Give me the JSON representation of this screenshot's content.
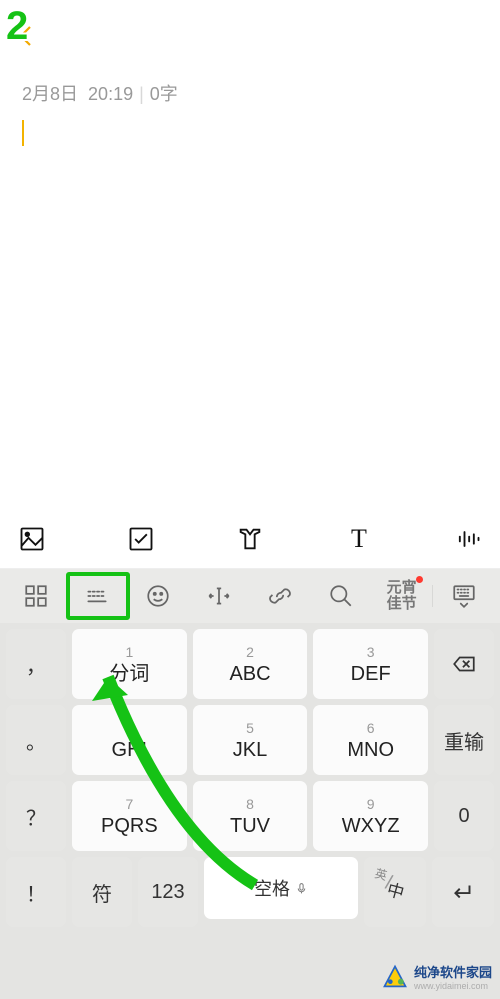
{
  "step_number": "2",
  "meta": {
    "date": "2月8日",
    "time": "20:19",
    "chars": "0字"
  },
  "toolbar": [
    "image",
    "checklist",
    "style",
    "text",
    "voice"
  ],
  "imebar": {
    "buttons": [
      "grid",
      "keyboard",
      "emoji",
      "cursor",
      "link",
      "search"
    ],
    "promo": "元宵\n佳节"
  },
  "keypad": {
    "left": [
      "，",
      "。",
      "？",
      "！"
    ],
    "row1": [
      {
        "n": "1",
        "t": "分词"
      },
      {
        "n": "2",
        "t": "ABC"
      },
      {
        "n": "3",
        "t": "DEF"
      }
    ],
    "row2": [
      {
        "n": "4",
        "t": "GHI"
      },
      {
        "n": "5",
        "t": "JKL"
      },
      {
        "n": "6",
        "t": "MNO"
      }
    ],
    "row3": [
      {
        "n": "7",
        "t": "PQRS"
      },
      {
        "n": "8",
        "t": "TUV"
      },
      {
        "n": "9",
        "t": "WXYZ"
      }
    ],
    "right": [
      "backspace",
      "重输",
      "0"
    ],
    "bottom": {
      "left": "符",
      "num": "123",
      "space": "空格",
      "lang_s": "英",
      "lang_m": "中"
    }
  },
  "watermark": {
    "l1": "纯净软件家园",
    "l2": "www.yidaimei.com"
  }
}
